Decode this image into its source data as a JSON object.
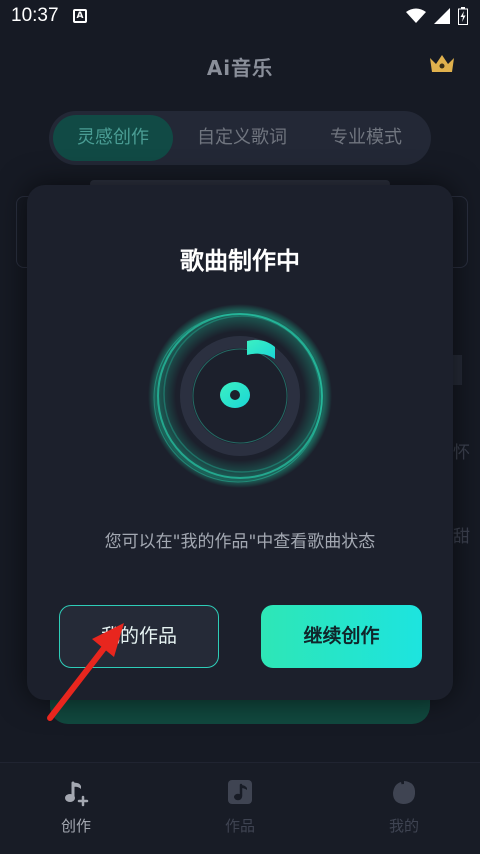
{
  "status_bar": {
    "time": "10:37",
    "notification_icon": "a-letter-icon",
    "icons": [
      "wifi-icon",
      "signal-icon",
      "battery-icon"
    ]
  },
  "header": {
    "title": "Ai音乐",
    "crown_icon": "crown-icon"
  },
  "tabs": [
    {
      "label": "灵感创作",
      "active": true
    },
    {
      "label": "自定义歌词",
      "active": false
    },
    {
      "label": "专业模式",
      "active": false
    }
  ],
  "background": {
    "fragment_1": "怀",
    "fragment_2": "甜"
  },
  "dialog": {
    "title": "歌曲制作中",
    "art_icon": "music-note-icon",
    "message": "您可以在\"我的作品\"中查看歌曲状态",
    "my_works_label": "我的作品",
    "continue_label": "继续创作"
  },
  "bottom_nav": [
    {
      "label": "创作",
      "icon": "music-note-plus-icon",
      "active": true
    },
    {
      "label": "作品",
      "icon": "music-album-icon",
      "active": false
    },
    {
      "label": "我的",
      "icon": "user-icon",
      "active": false
    }
  ],
  "colors": {
    "accent": "#2ee6b6",
    "background": "#161a24",
    "annotation_arrow": "#e8261e"
  }
}
